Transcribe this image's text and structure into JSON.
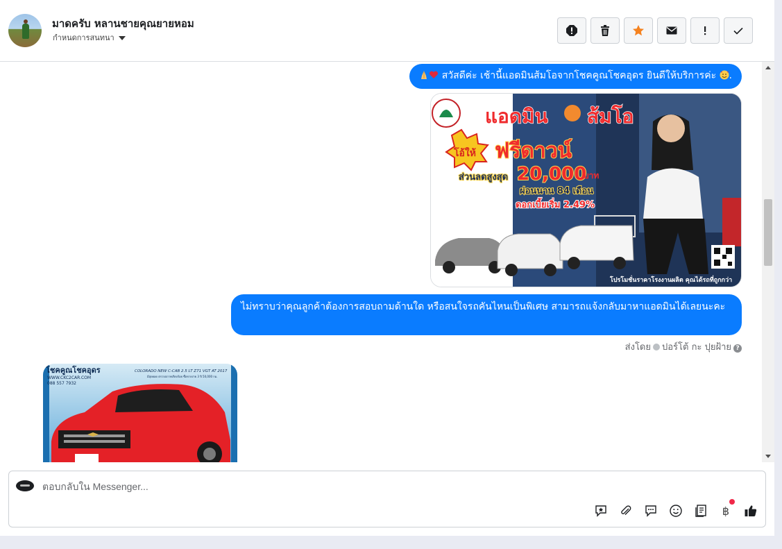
{
  "header": {
    "contact_name": "มาดครับ หลานชายคุณยายหอม",
    "contact_sub": "กำหนดการสนทนา",
    "actions": [
      "spam-icon",
      "trash-icon",
      "star-icon",
      "mail-icon",
      "important-icon",
      "check-icon"
    ]
  },
  "messages": {
    "greeting": "สวัสดีค่ะ เช้านี้แอดมินส้มโอจากโชคคูณโชคอุดร ยินดีให้บริการค่ะ",
    "greeting_end": ".",
    "question": "ไม่ทราบว่าคุณลูกค้าต้องการสอบถามด้านใด หรือสนใจรถคันไหนเป็นพิเศษ สามารถแจ้งกลับมาหาแอดมินได้เลยนะคะ",
    "sent_by_label": "ส่งโดย",
    "sent_by_name": "ปอร์โต้ กะ ปุยฝ้าย"
  },
  "promo": {
    "title": "แอดมิน",
    "title2": "ส้มโอ",
    "oh_hai": "โอ้ให้",
    "free_down": "ฟรีดาวน์",
    "discount_label": "ส่วนลดสูงสุด",
    "discount_value": "20,000",
    "discount_unit": "บาท",
    "installment": "ผ่อนนาน 84 เดือน",
    "interest": "ดอกเบี้ยเริ่ม 2.49%",
    "footer": "โปรโมชั่นราคาโรงงานผลิต คุณได้รถที่ถูกกว่า"
  },
  "car_card": {
    "brand": "โชคคูณโชคอุดร",
    "web": "WWW.CKC2CAR.COM",
    "phone": "088 557 7932",
    "model": "COLORADO NEW C-CAB 2.5 LT Z71 VGT AT 2017",
    "detail": "มีสุดยอด ตรวจสภาพเรียบร้อย ซื้อขายง่าย 3 ปี 50,000 กม."
  },
  "composer": {
    "placeholder": "ตอบกลับใน Messenger...",
    "tools": [
      "saved-reply-icon",
      "attachment-icon",
      "message-icon",
      "emoji-icon",
      "notes-icon",
      "baht-icon",
      "like-icon"
    ],
    "baht_symbol": "฿"
  },
  "colors": {
    "accent": "#0a7cff",
    "star": "#f5821f"
  }
}
